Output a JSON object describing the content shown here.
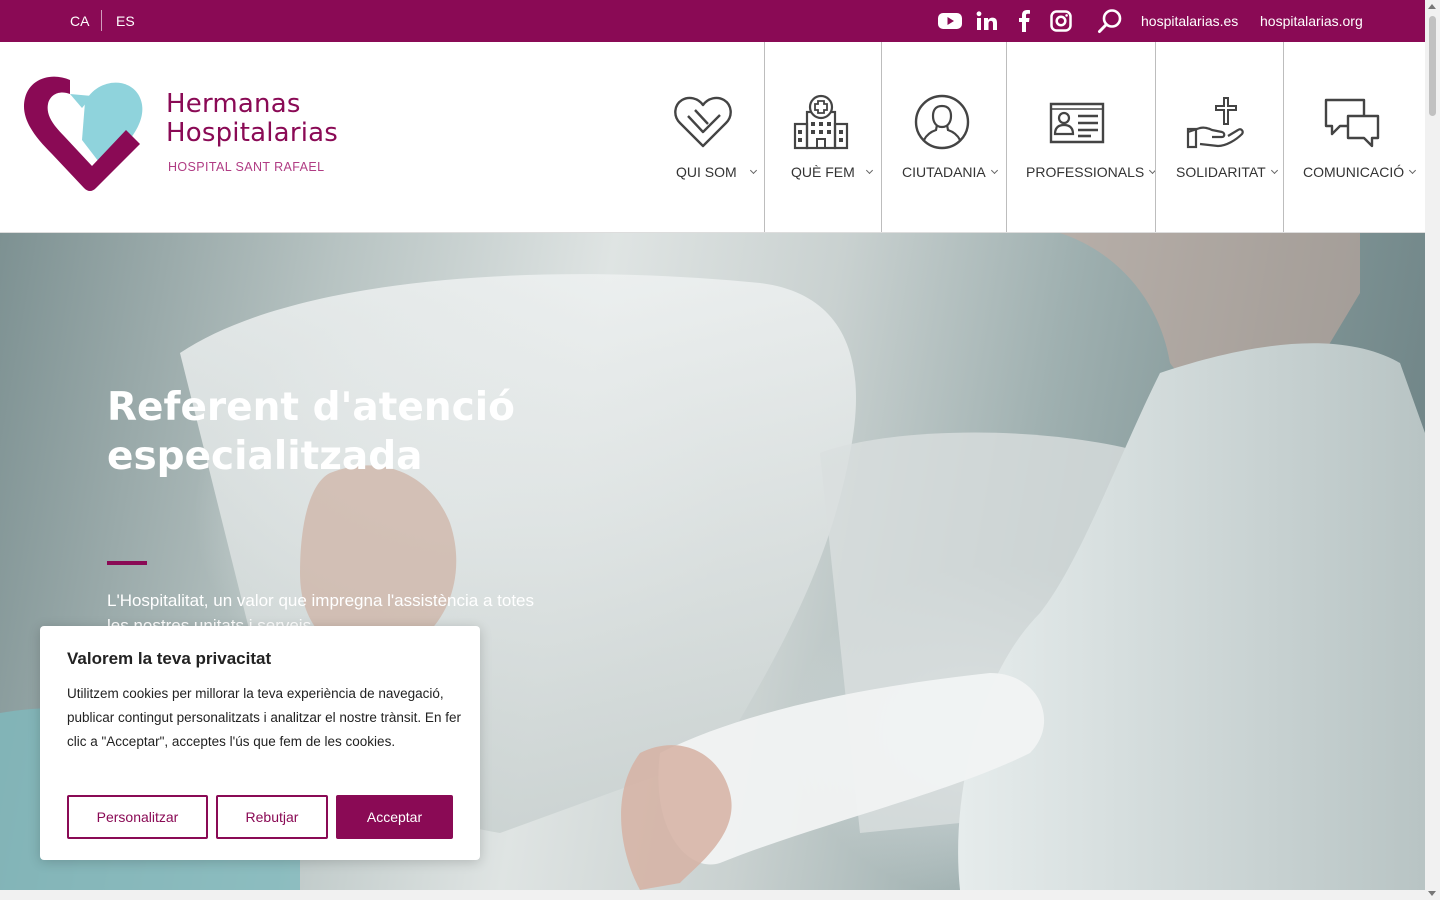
{
  "topbar": {
    "languages": [
      "CA",
      "ES"
    ],
    "social": [
      "youtube-icon",
      "linkedin-icon",
      "facebook-icon",
      "instagram-icon"
    ],
    "search_icon": "search-icon",
    "links": [
      "hospitalarias.es",
      "hospitalarias.org"
    ],
    "background": "#8a0a55"
  },
  "logo": {
    "title_line1": "Hermanas",
    "title_line2": "Hospitalarias",
    "subtitle": "HOSPITAL SANT RAFAEL",
    "colors": {
      "brand": "#8a0a55",
      "accent": "#8fd3dc"
    }
  },
  "nav": [
    {
      "label": "QUI SOM",
      "icon": "heart-icon"
    },
    {
      "label": "QUÈ FEM",
      "icon": "hospital-icon"
    },
    {
      "label": "CIUTADANIA",
      "icon": "person-icon"
    },
    {
      "label": "PROFESSIONALS",
      "icon": "id-card-icon"
    },
    {
      "label": "SOLIDARITAT",
      "icon": "cross-hand-icon"
    },
    {
      "label": "COMUNICACIÓ",
      "icon": "chat-icon"
    }
  ],
  "hero": {
    "title": "Referent d'atenció especialitzada",
    "subtitle": "L'Hospitalitat, un valor que impregna l'assistència a totes les nostres unitats i serveis."
  },
  "cookie": {
    "title": "Valorem la teva privacitat",
    "text": "Utilitzem cookies per millorar la teva experiència de navegació, publicar contingut personalitzats i analitzar el nostre trànsit. En fer clic a \"Acceptar\", acceptes l'ús que fem de les cookies.",
    "buttons": {
      "customize": "Personalitzar",
      "reject": "Rebutjar",
      "accept": "Acceptar"
    }
  }
}
